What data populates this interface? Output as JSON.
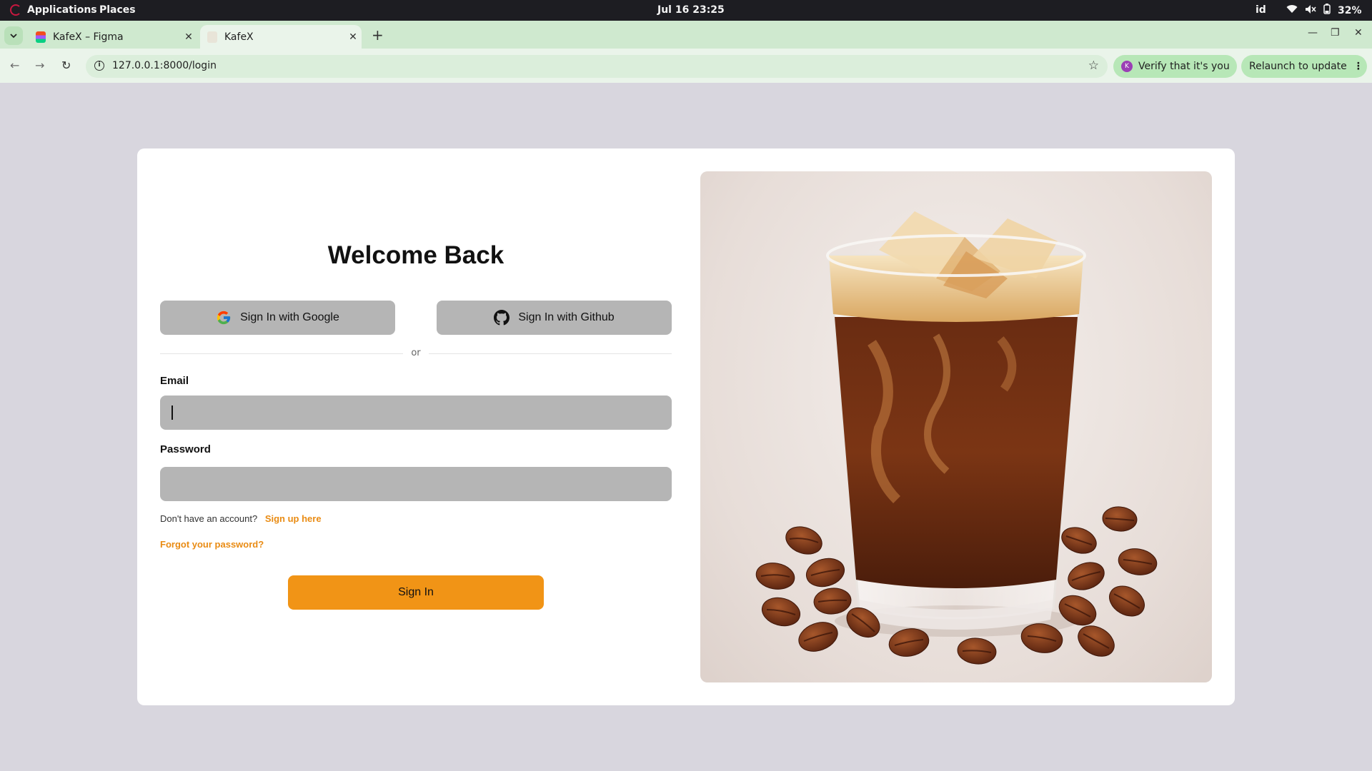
{
  "system_bar": {
    "applications": "Applications",
    "places": "Places",
    "clock": "Jul 16  23:25",
    "language": "id",
    "battery": "32%"
  },
  "browser": {
    "tabs": [
      {
        "title": "KafeX – Figma",
        "icon": "figma-icon"
      },
      {
        "title": "KafeX",
        "icon": "kafex-favicon"
      }
    ],
    "url": "127.0.0.1:8000/login",
    "verify_label": "Verify that it's you",
    "relaunch_label": "Relaunch to update"
  },
  "login": {
    "heading": "Welcome Back",
    "google_label": "Sign In with Google",
    "github_label": "Sign In with Github",
    "divider_text": "or",
    "email_label": "Email",
    "email_value": "",
    "password_label": "Password",
    "password_value": "",
    "no_account_text": "Don't have an account?",
    "signup_link": "Sign up here",
    "forgot_link": "Forgot your password?",
    "submit_label": "Sign In"
  },
  "colors": {
    "accent": "#f19416",
    "link": "#e98b13",
    "page_bg": "#d8d6de",
    "input_bg": "#b5b5b5"
  }
}
